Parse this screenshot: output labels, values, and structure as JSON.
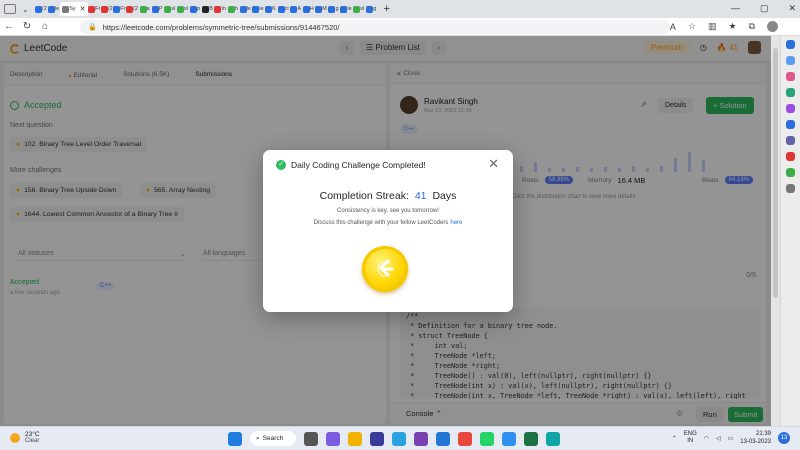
{
  "browser": {
    "tabs": [
      {
        "fav": "#2a6edb",
        "label": "(2"
      },
      {
        "fav": "#2a6edb",
        "label": "le"
      },
      {
        "fav": "#7a7a7a",
        "label": "Sy",
        "active": true
      },
      {
        "fav": "#e03535",
        "label": "Fr"
      },
      {
        "fav": "#e03535",
        "label": "(2"
      },
      {
        "fav": "#2a6edb",
        "label": "Fr"
      },
      {
        "fav": "#e03535",
        "label": "(2"
      },
      {
        "fav": "#3fae49",
        "label": "a"
      },
      {
        "fav": "#2a6edb",
        "label": "P"
      },
      {
        "fav": "#3fae49",
        "label": "sl"
      },
      {
        "fav": "#3fae49",
        "label": "sl"
      },
      {
        "fav": "#2a6edb",
        "label": "p"
      },
      {
        "fav": "#222222",
        "label": "B"
      },
      {
        "fav": "#e03535",
        "label": "In"
      },
      {
        "fav": "#3fae49",
        "label": "h"
      },
      {
        "fav": "#2a6edb",
        "label": "le"
      },
      {
        "fav": "#2a6edb",
        "label": "le"
      },
      {
        "fav": "#2a6edb",
        "label": "K"
      },
      {
        "fav": "#2a6edb",
        "label": "ci"
      },
      {
        "fav": "#2a6edb",
        "label": "A"
      },
      {
        "fav": "#2a6edb",
        "label": "H"
      },
      {
        "fav": "#2a6edb",
        "label": "M"
      },
      {
        "fav": "#2a6edb",
        "label": "g"
      },
      {
        "fav": "#2a6edb",
        "label": "le"
      },
      {
        "fav": "#3fae49",
        "label": "sl"
      },
      {
        "fav": "#2a6edb",
        "label": "g"
      }
    ],
    "url": "https://leetcode.com/problems/symmetric-tree/submissions/914467520/"
  },
  "header": {
    "logo": "LeetCode",
    "problem_list": "Problem List",
    "premium": "Premium",
    "streak_count": "41"
  },
  "left": {
    "tabs": [
      "Description",
      "Editorial",
      "Solutions (6.5K)",
      "Submissions"
    ],
    "status": "Accepted",
    "next_question_label": "Next question",
    "next_question": "102. Binary Tree Level Order Traversal",
    "more_challenges_label": "More challenges",
    "challenges": [
      "156. Binary Tree Upside Down",
      "565. Array Nesting",
      "1644. Lowest Common Ancestor of a Binary Tree II"
    ],
    "filter_status": "All statuses",
    "filter_lang": "All languages",
    "row": {
      "status": "Accepted",
      "time": "a few seconds ago",
      "lang": "C++"
    }
  },
  "right": {
    "close_label": "Close",
    "user_name": "Ravikant Singh",
    "date": "Mar 13, 2023 21:38",
    "lang": "C++",
    "details": "Details",
    "solution": "Solution",
    "beats_label": "Beats",
    "runtime_beats": "58.39%",
    "memory_label": "Memory",
    "memory_value": "16.4 MB",
    "memory_beats": "64.13%",
    "chart_hint": "Click the distribution chart to view more details",
    "count": "0/5",
    "code_lines": [
      "/**",
      " * Definition for a binary tree node.",
      " * struct TreeNode {",
      " *     int val;",
      " *     TreeNode *left;",
      " *     TreeNode *right;",
      " *     TreeNode() : val(0), left(nullptr), right(nullptr) {}",
      " *     TreeNode(int x) : val(x), left(nullptr), right(nullptr) {}",
      " *     TreeNode(int x, TreeNode *left, TreeNode *right) : val(x), left(left), right"
    ],
    "console": "Console",
    "run": "Run",
    "submit": "Submit"
  },
  "modal": {
    "title": "Daily Coding Challenge Completed!",
    "streak_prefix": "Completion Streak:",
    "streak_value": "41",
    "streak_suffix": "Days",
    "message": "Consistency is key, see you tomorrow!",
    "discuss": "Discuss this challenge with your fellow LeetCoders",
    "discuss_link": "here"
  },
  "taskbar": {
    "temp": "23°C",
    "weather": "Clear",
    "search": "Search",
    "lang_line1": "ENG",
    "lang_line2": "IN",
    "time": "21:39",
    "date": "13-03-2023",
    "notifications": "13"
  },
  "colors": {
    "accent_green": "#2cbb5d",
    "accent_orange": "#ffa116",
    "link_blue": "#2a6edb"
  }
}
